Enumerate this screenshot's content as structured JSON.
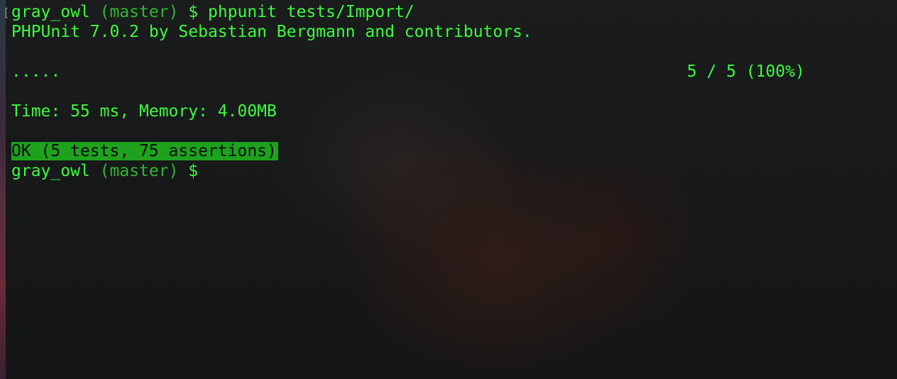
{
  "terminal": {
    "prompt": {
      "user": "gray_owl",
      "branch": "(master)",
      "symbol": "$"
    },
    "command": "phpunit tests/Import/",
    "version_line": "PHPUnit 7.0.2 by Sebastian Bergmann and contributors.",
    "progress_dots": ".....",
    "progress_count": "5 / 5 (100%)",
    "time_memory": "Time: 55 ms, Memory: 4.00MB",
    "result": "OK (5 tests, 75 assertions)"
  },
  "colors": {
    "text": "#3dfb3d",
    "ok_background": "#1ea21e"
  }
}
